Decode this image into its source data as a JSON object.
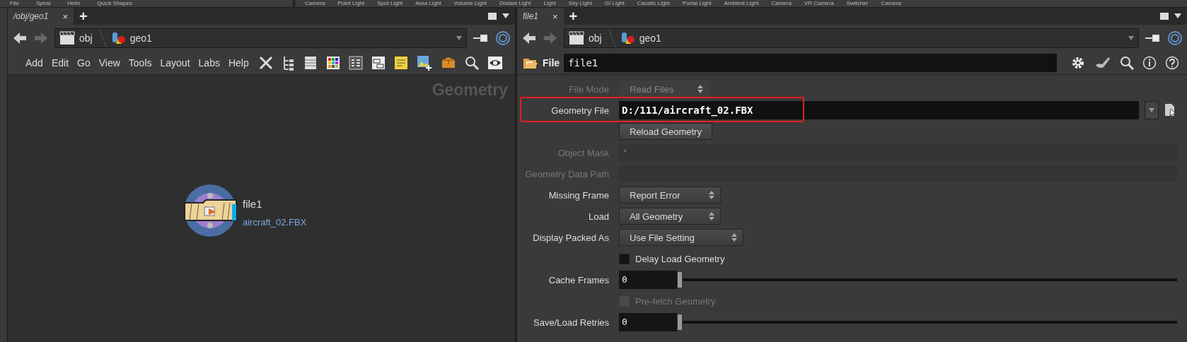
{
  "shelf": {
    "left": [
      "File",
      "Spiral",
      "Helix",
      "Quick Shapes"
    ],
    "right": [
      "Camera",
      "Point Light",
      "Spot Light",
      "Area Light",
      "Volume Light",
      "Distant Light",
      "Light",
      "Sky Light",
      "GI Light",
      "Caustic Light",
      "Portal Light",
      "Ambient Light",
      "Camera",
      "VR Camera",
      "Switcher",
      "Camera"
    ]
  },
  "network_pane": {
    "tab": {
      "label": "/obj/geo1",
      "close": "×"
    },
    "add_tab": "+",
    "path": [
      "obj",
      "geo1"
    ],
    "menu": [
      "Add",
      "Edit",
      "Go",
      "View",
      "Tools",
      "Layout",
      "Labs",
      "Help"
    ],
    "context_label": "Geometry",
    "node": {
      "name": "file1",
      "file": "aircraft_02.FBX"
    }
  },
  "parameter_pane": {
    "tab": {
      "label": "file1",
      "close": "×"
    },
    "add_tab": "+",
    "path": [
      "obj",
      "geo1"
    ],
    "node_type": "File",
    "node_name": "file1",
    "parameters": [
      {
        "kind": "menu",
        "label": "File Mode",
        "value": "Read Files",
        "disabled": true
      },
      {
        "kind": "file",
        "label": "Geometry File",
        "value": "D:/111/aircraft_02.FBX",
        "highlighted": true
      },
      {
        "kind": "button",
        "label": "Reload Geometry"
      },
      {
        "kind": "string",
        "label": "Object Mask",
        "value": "*",
        "disabled": true
      },
      {
        "kind": "string",
        "label": "Geometry Data Path",
        "disabled": true
      },
      {
        "kind": "menu",
        "label": "Missing Frame",
        "value": "Report Error",
        "disabled": false
      },
      {
        "kind": "menu",
        "label": "Load",
        "value": "All Geometry",
        "disabled": false
      },
      {
        "kind": "menu",
        "label": "Display Packed As",
        "value": "Use File Setting",
        "disabled": false
      },
      {
        "kind": "checkbox",
        "label": "Delay Load Geometry",
        "checked": false,
        "disabled": false
      },
      {
        "kind": "slider",
        "label": "Cache Frames",
        "value": "0",
        "level": 0
      },
      {
        "kind": "checkbox",
        "label": "Pre-fetch Geometry",
        "checked": false,
        "disabled": true
      },
      {
        "kind": "slider",
        "label": "Save/Load Retries",
        "value": "0",
        "level": 0
      }
    ]
  }
}
